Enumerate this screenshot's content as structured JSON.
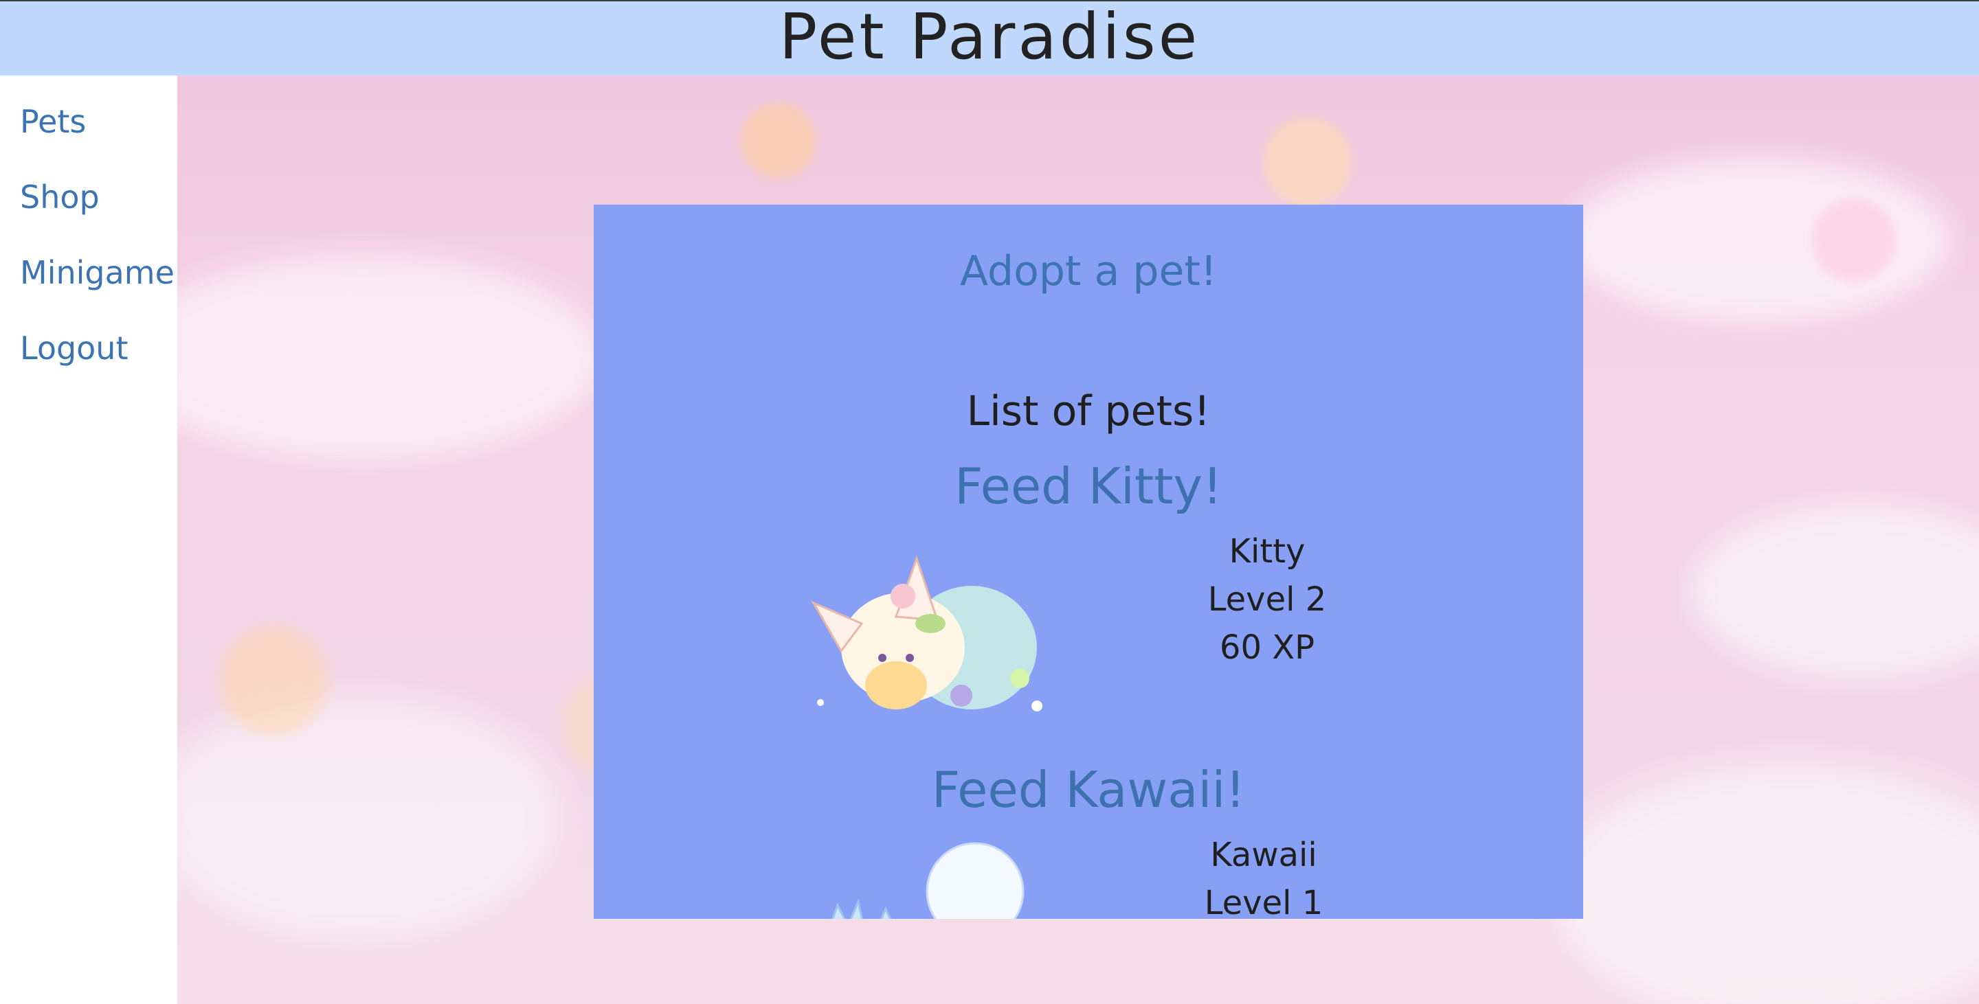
{
  "header": {
    "title": "Pet Paradise"
  },
  "sidebar": {
    "items": [
      {
        "label": "Pets"
      },
      {
        "label": "Shop"
      },
      {
        "label": "Minigame"
      },
      {
        "label": "Logout"
      }
    ]
  },
  "main": {
    "adopt_link": "Adopt a pet!",
    "list_heading": "List of pets!",
    "pets": [
      {
        "feed_label": "Feed Kitty!",
        "name": "Kitty",
        "level": "Level 2",
        "xp": "60 XP"
      },
      {
        "feed_label": "Feed Kawaii!",
        "name": "Kawaii",
        "level": "Level 1"
      }
    ]
  },
  "colors": {
    "header_bg": "#bfd8fb",
    "panel_bg": "#87a0f5",
    "link": "#3c74b3",
    "text": "#1f1f1f"
  }
}
